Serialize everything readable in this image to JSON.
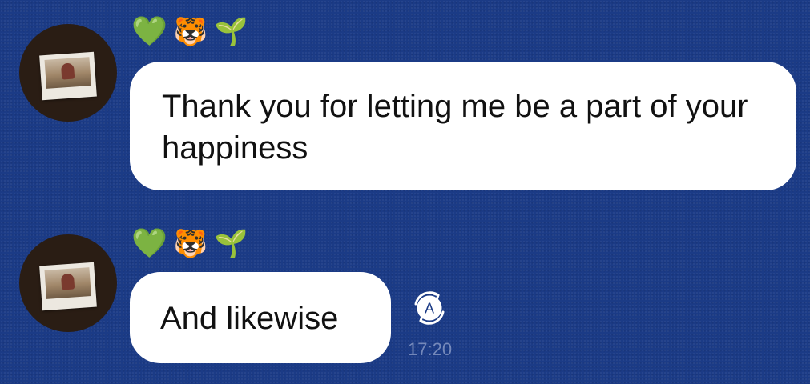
{
  "chat": {
    "messages": [
      {
        "reactions": [
          "💚",
          "🐯",
          "🌱"
        ],
        "text": "Thank you for letting me be a part of your happiness",
        "avatar_icon": "profile-photo"
      },
      {
        "reactions": [
          "💚",
          "🐯",
          "🌱"
        ],
        "text": "And likewise",
        "avatar_icon": "profile-photo",
        "time": "17:20",
        "translate_label": "A"
      }
    ]
  },
  "colors": {
    "background": "#1b3b86",
    "bubble": "#ffffff",
    "text": "#111111"
  }
}
